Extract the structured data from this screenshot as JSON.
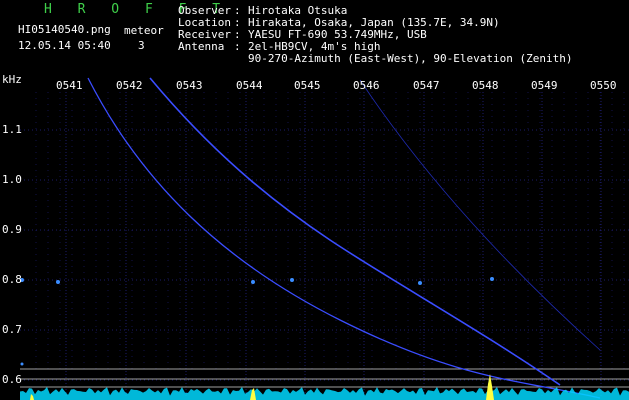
{
  "header": {
    "brand": "H R O F F T",
    "filename": "HI05140540.png",
    "meteor_label": "meteor",
    "datetime": "12.05.14 05:40",
    "meteor_count": "3",
    "info": [
      {
        "key": "Observer",
        "value": "Hirotaka Otsuka"
      },
      {
        "key": "Location",
        "value": "Hirakata, Osaka, Japan (135.7E, 34.9N)"
      },
      {
        "key": "Receiver",
        "value": "YAESU FT-690 53.749MHz, USB"
      },
      {
        "key": "Antenna",
        "value": "2el-HB9CV, 4m's high"
      },
      {
        "key": "",
        "value": "90-270-Azimuth (East-West), 90-Elevation (Zenith)"
      }
    ]
  },
  "spectrogram": {
    "y_unit": "kHz",
    "y_ticks": [
      "1.1",
      "1.0",
      "0.9",
      "0.8",
      "0.7",
      "0.6"
    ],
    "x_ticks": [
      "0541",
      "0542",
      "0543",
      "0544",
      "0545",
      "0546",
      "0547",
      "0548",
      "0549",
      "0550"
    ],
    "trace_color": "#3a4dff",
    "grid_color": "#1c1c6a",
    "noise_color": "#00d8ff",
    "burst_color": "#ffff40",
    "line_color": "#a0a0a0"
  }
}
